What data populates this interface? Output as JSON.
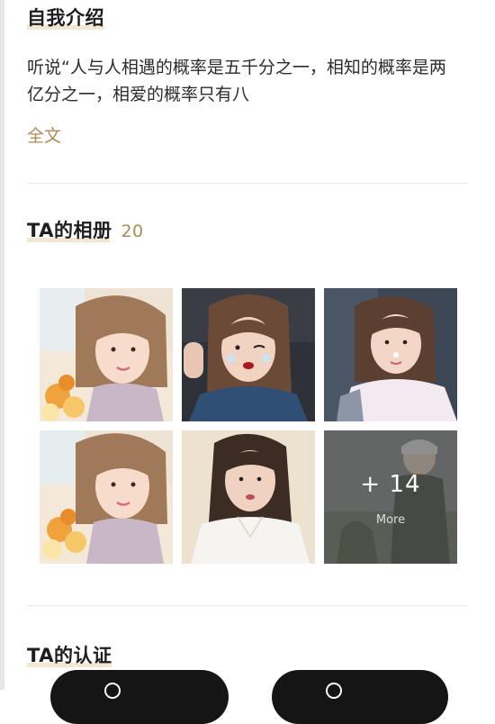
{
  "intro": {
    "title": "自我介绍",
    "text": "听说“人与人相遇的概率是五千分之一，相知的概率是两亿分之一，相爱的概率只有八",
    "more_label": "全文"
  },
  "album": {
    "title": "TA的相册",
    "count": "20",
    "more_count": "+ 14",
    "more_label": "More"
  },
  "certification": {
    "title": "TA的认证"
  },
  "colors": {
    "accent": "#b08a57",
    "button_bg": "#151515"
  }
}
